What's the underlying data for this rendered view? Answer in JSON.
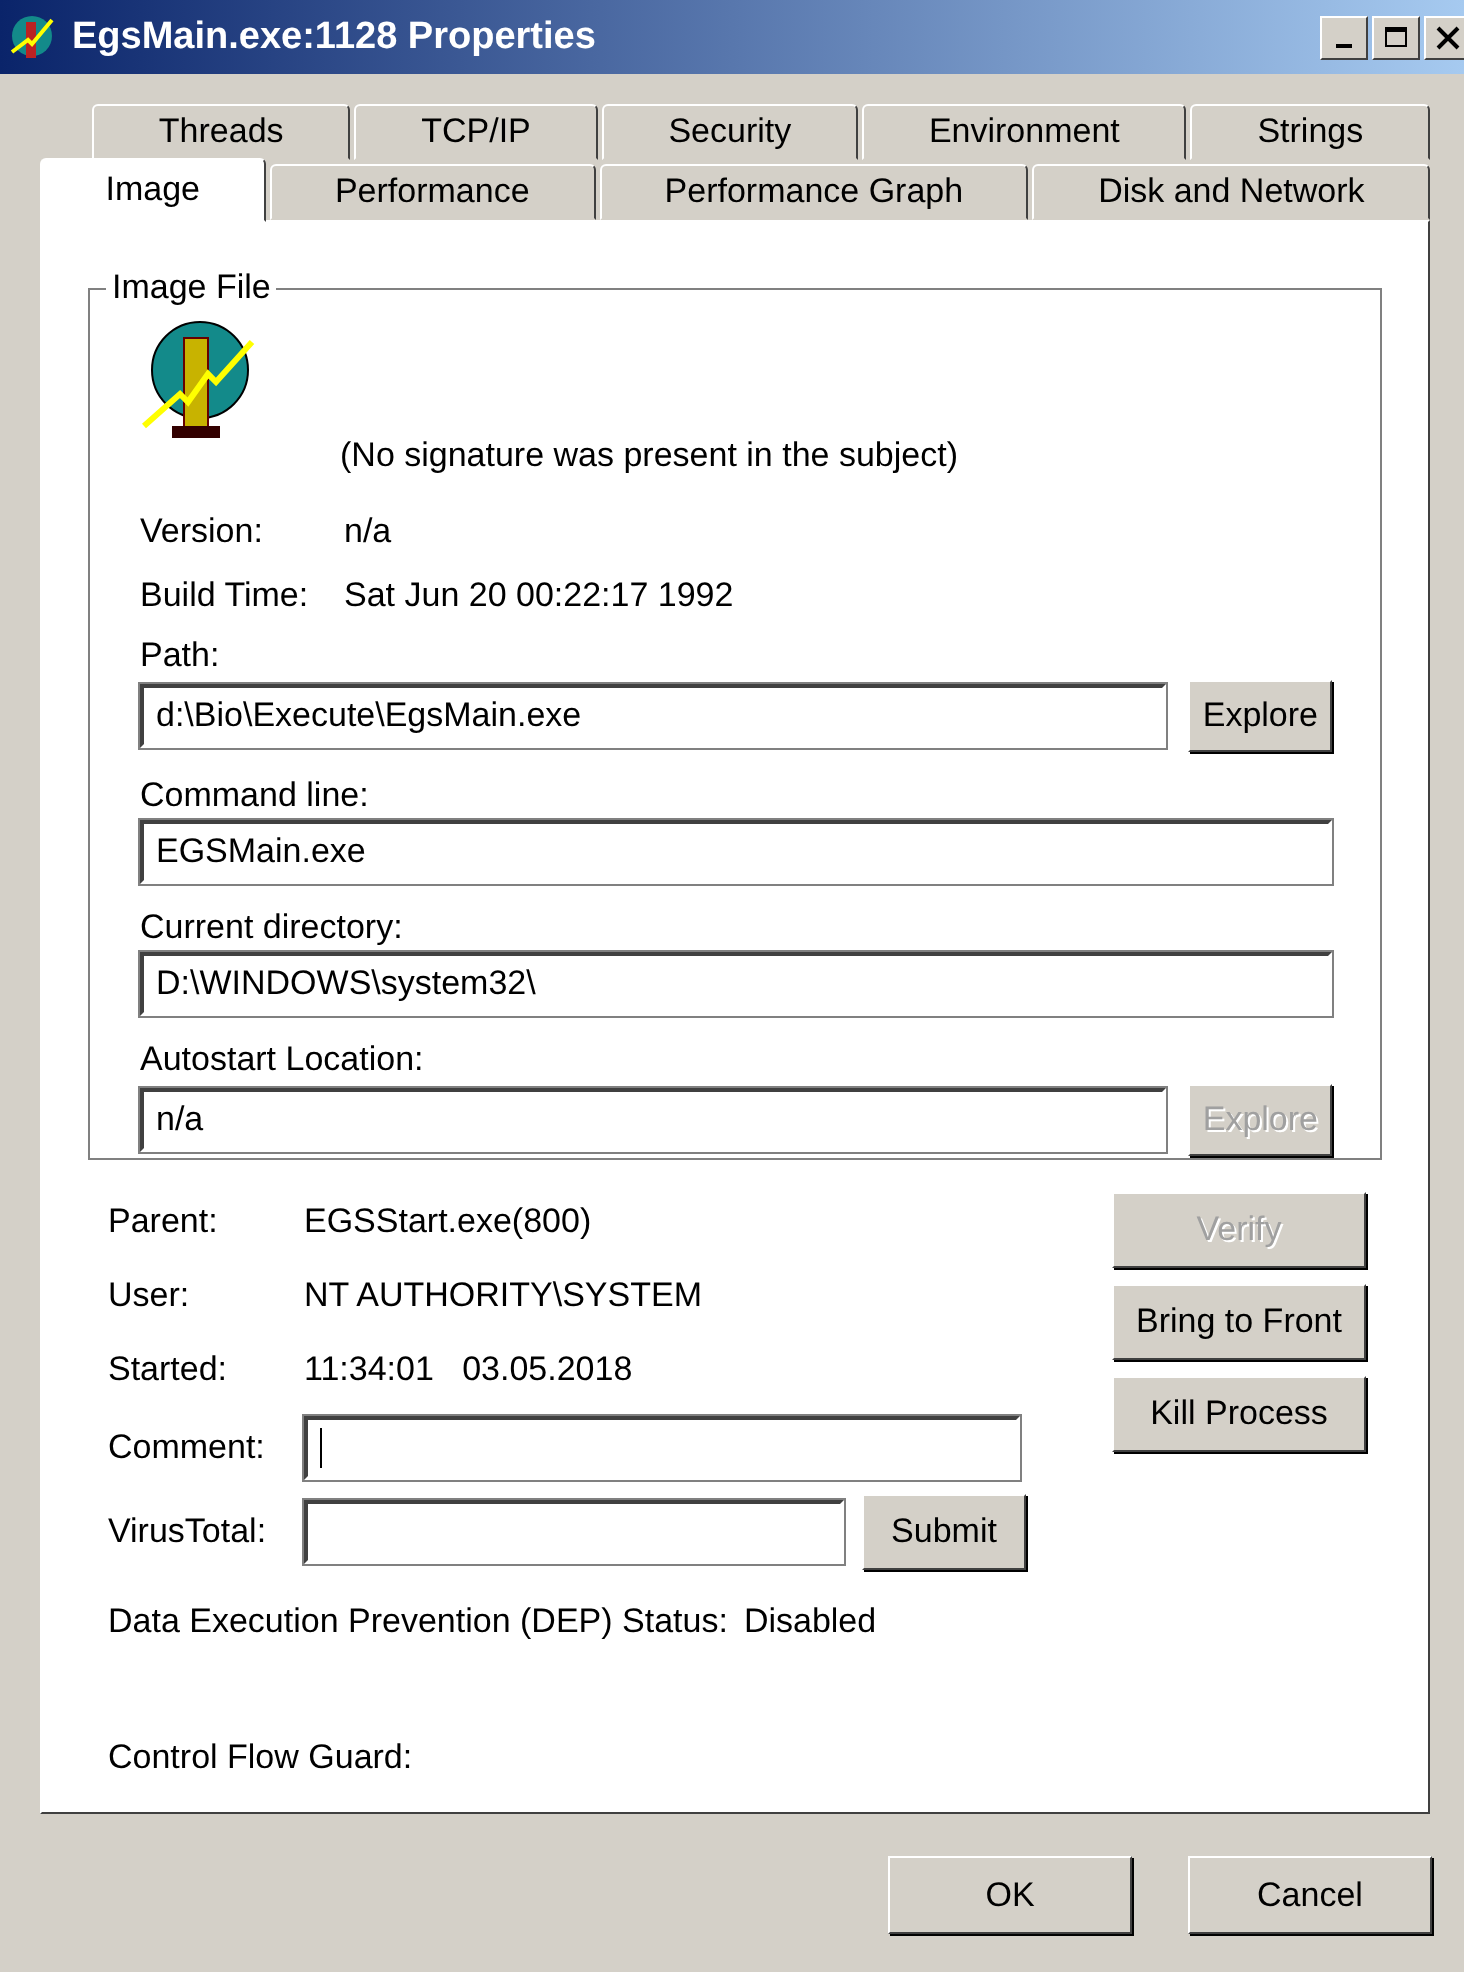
{
  "window": {
    "title": "EgsMain.exe:1128 Properties"
  },
  "tabs": [
    [
      {
        "label": "Threads",
        "selected": false
      },
      {
        "label": "TCP/IP",
        "selected": false
      },
      {
        "label": "Security",
        "selected": false
      },
      {
        "label": "Environment",
        "selected": false
      },
      {
        "label": "Strings",
        "selected": false
      }
    ],
    [
      {
        "label": "Image",
        "selected": true
      },
      {
        "label": "Performance",
        "selected": false
      },
      {
        "label": "Performance Graph",
        "selected": false
      },
      {
        "label": "Disk and Network",
        "selected": false
      }
    ]
  ],
  "image_file": {
    "title": "Image File",
    "signature": "(No signature was present in the subject)",
    "info": [
      {
        "label": "Version:",
        "value": "n/a"
      },
      {
        "label": "Build Time:",
        "value": "Sat Jun 20 00:22:17 1992"
      }
    ],
    "fields": [
      {
        "label": "Path:",
        "value": "d:\\Bio\\Execute\\EgsMain.exe",
        "button": {
          "label": "Explore",
          "disabled": false
        }
      },
      {
        "label": "Command line:",
        "value": "EGSMain.exe"
      },
      {
        "label": "Current directory:",
        "value": "D:\\WINDOWS\\system32\\"
      },
      {
        "label": "Autostart Location:",
        "value": "n/a",
        "button": {
          "label": "Explore",
          "disabled": true
        }
      }
    ]
  },
  "process": {
    "info": [
      {
        "label": "Parent:",
        "value": "EGSStart.exe(800)"
      },
      {
        "label": "User:",
        "value": "NT AUTHORITY\\SYSTEM"
      },
      {
        "label": "Started:",
        "value": "11:34:01   03.05.2018"
      }
    ],
    "comment": {
      "label": "Comment:",
      "focused": true
    },
    "virustotal": {
      "label": "VirusTotal:",
      "button": "Submit"
    },
    "dep": {
      "label": "Data Execution Prevention (DEP) Status:",
      "value": "Disabled"
    },
    "cfg": {
      "label": "Control Flow Guard:"
    },
    "buttons": [
      {
        "label": "Verify",
        "disabled": true
      },
      {
        "label": "Bring to Front",
        "disabled": false
      },
      {
        "label": "Kill Process",
        "disabled": false
      }
    ]
  },
  "footer": [
    {
      "label": "OK"
    },
    {
      "label": "Cancel"
    }
  ]
}
